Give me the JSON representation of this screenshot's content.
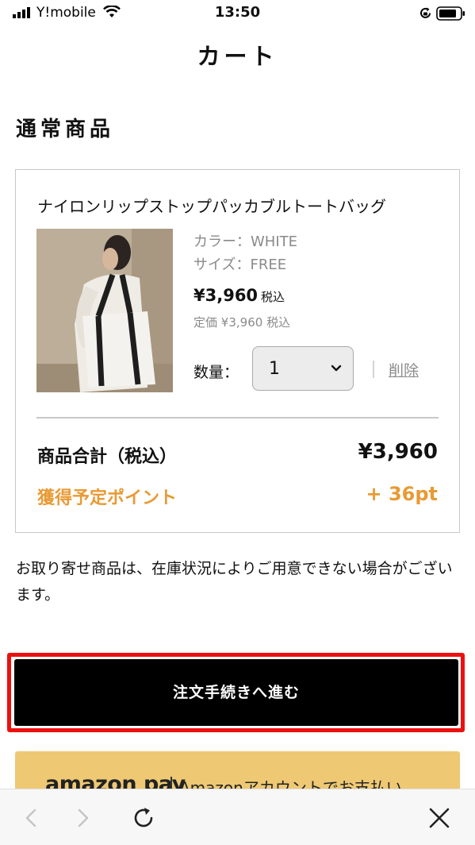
{
  "status_bar": {
    "carrier": "Y!mobile",
    "time": "13:50"
  },
  "page": {
    "title": "カート"
  },
  "section": {
    "heading": "通常商品"
  },
  "cart_item": {
    "name": "ナイロンリップストップパッカブルトートバッグ",
    "color_label": "カラー：",
    "color_value": "WHITE",
    "size_label": "サイズ：",
    "size_value": "FREE",
    "price": "¥3,960",
    "price_tax_note": "税込",
    "list_price_label": "定価",
    "list_price": "¥3,960",
    "list_price_tax_note": "税込",
    "quantity_label": "数量：",
    "quantity_value": "1",
    "delete_label": "削除"
  },
  "summary": {
    "subtotal_label": "商品合計（税込）",
    "subtotal_value": "¥3,960",
    "points_label": "獲得予定ポイント",
    "points_value": "+ 36pt"
  },
  "notice": "お取り寄せ商品は、在庫状況によりご用意できない場合がございます。",
  "checkout": {
    "label": "注文手続きへ進む"
  },
  "amazon_pay": {
    "logo": "amazon pay",
    "label": "Amazonアカウントでお支払い"
  },
  "colors": {
    "accent": "#e89a35",
    "highlight": "#ec1010",
    "checkout_bg": "#000000",
    "amazon_pay_bg": "#eec873"
  },
  "icons": [
    "signal-icon",
    "wifi-icon",
    "rotation-lock-icon",
    "battery-icon",
    "chevron-down-icon",
    "back-icon",
    "forward-icon",
    "reload-icon",
    "close-icon"
  ]
}
